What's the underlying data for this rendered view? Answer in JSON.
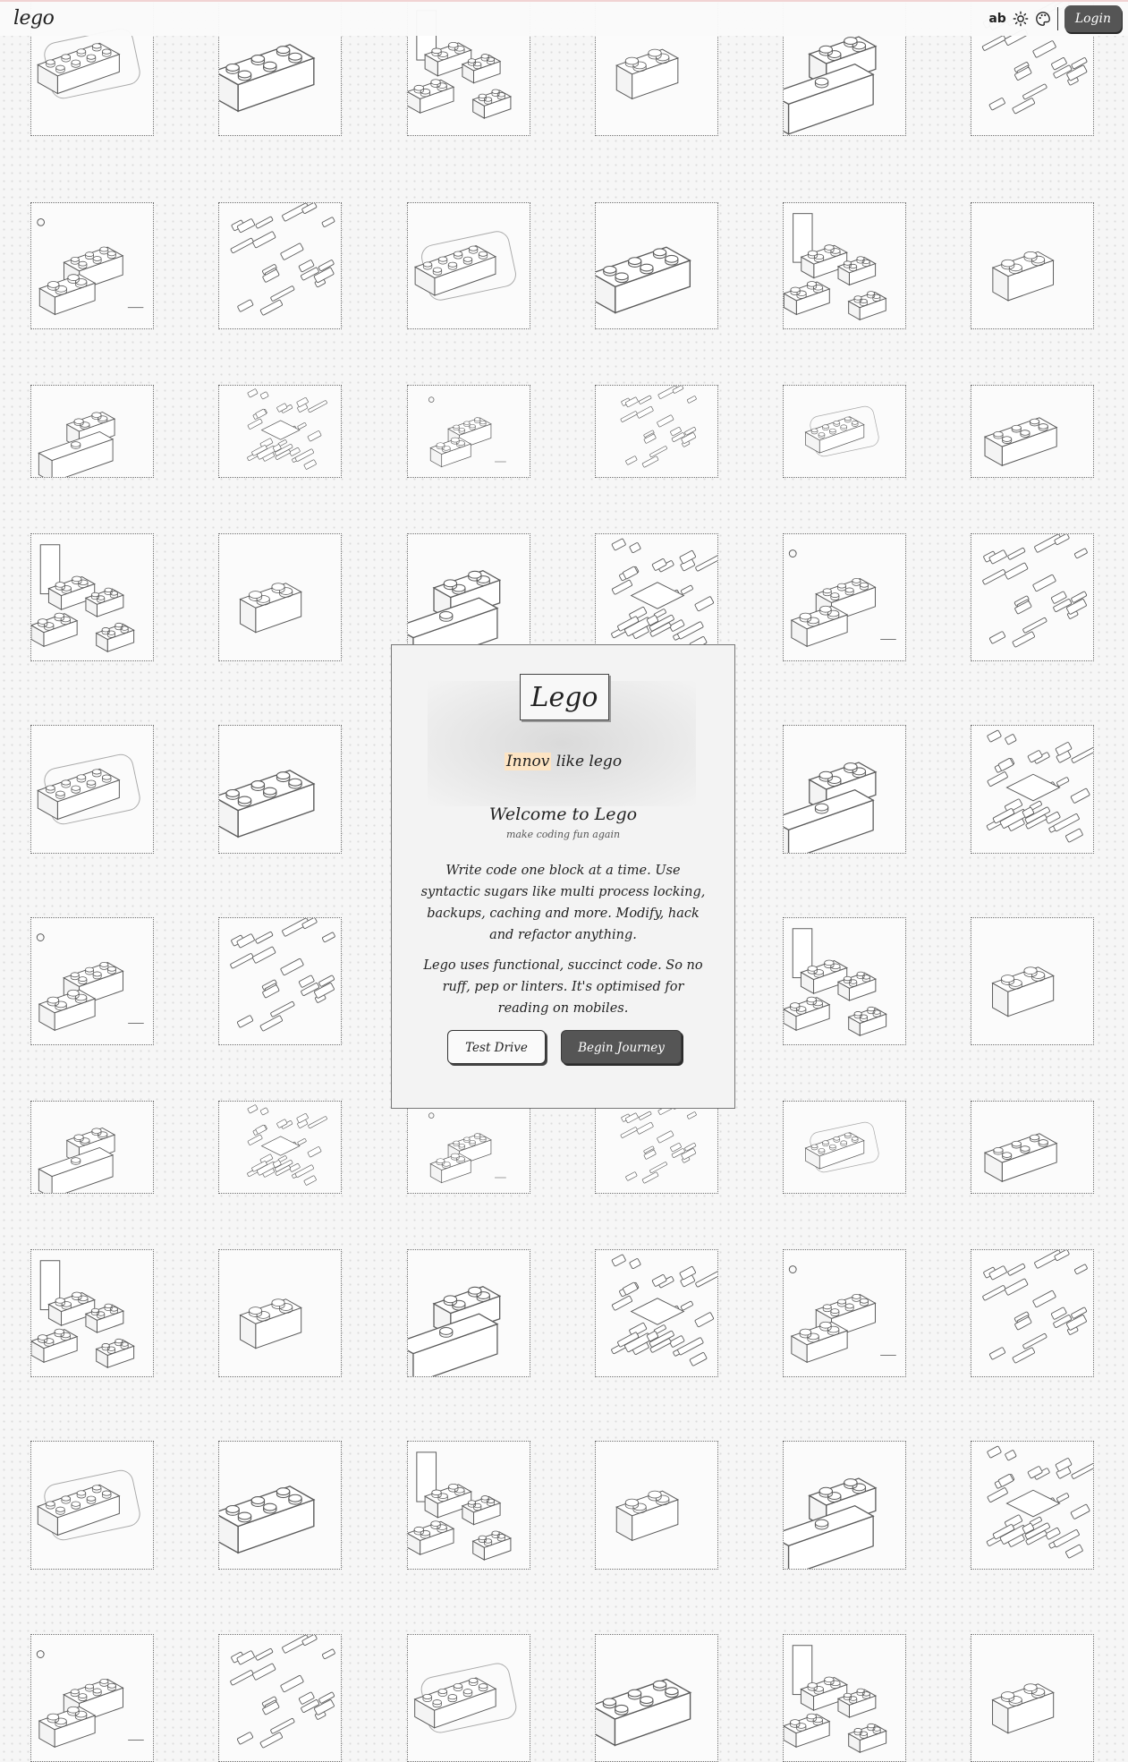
{
  "header": {
    "brand": "lego",
    "text_toggle_label": "ab",
    "theme_icon": "sun-icon",
    "palette_icon": "palette-icon",
    "login_label": "Login"
  },
  "background_tiles": {
    "illustration_types": [
      "brick-outline",
      "brick-2x4",
      "brick-pile",
      "brick-small",
      "brick-stair",
      "plate-scatter",
      "brick-logo",
      "plate-scatter-dense"
    ]
  },
  "modal": {
    "logo": "Lego",
    "tagline_highlight": "Innov",
    "tagline_rest": " like lego",
    "welcome": "Welcome to Lego",
    "subtitle": "make coding fun again",
    "paragraph1": "Write code one block at a time. Use syntactic sugars like multi process locking, backups, caching and more. Modify, hack and refactor anything.",
    "paragraph2": "Lego uses functional, succinct code. So no ruff, pep or linters. It's optimised for reading on mobiles.",
    "test_drive_label": "Test Drive",
    "begin_journey_label": "Begin Journey"
  },
  "colors": {
    "accent_button": "#555555",
    "highlight": "#fde4c3",
    "page_background": "#f6f6f6"
  }
}
